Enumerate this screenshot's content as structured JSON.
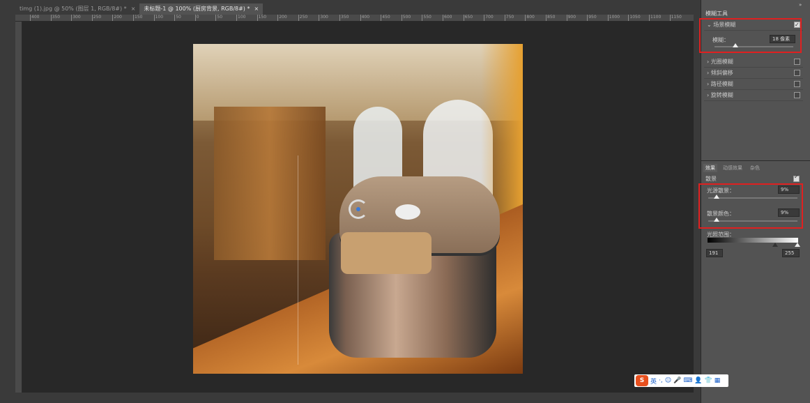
{
  "tabs": [
    {
      "label": "timg (1).jpg @ 50% (图层 1, RGB/8#) *",
      "close": "×",
      "active": false
    },
    {
      "label": "未标题-1 @ 100% (厨房背景, RGB/8#) *",
      "close": "×",
      "active": true
    }
  ],
  "ruler": {
    "top_labels": [
      "400",
      "350",
      "300",
      "250",
      "200",
      "150",
      "100",
      "50",
      "0",
      "50",
      "100",
      "150",
      "200",
      "250",
      "300",
      "350",
      "400",
      "450",
      "500",
      "550",
      "600",
      "650",
      "700",
      "750",
      "800",
      "850",
      "900",
      "950",
      "1000",
      "1050",
      "1100",
      "1150"
    ]
  },
  "blur_tools": {
    "tab": "模糊工具",
    "collapse_icon": "double-arrow-icon",
    "field_blur": {
      "label": "场景模糊",
      "checked": true,
      "blur_label": "模糊：",
      "blur_value": "18 像素",
      "slider_pct": 30
    },
    "others": [
      {
        "label": "光圈模糊",
        "checked": false
      },
      {
        "label": "倾斜偏移",
        "checked": false
      },
      {
        "label": "路径模糊",
        "checked": false
      },
      {
        "label": "旋转模糊",
        "checked": false
      }
    ]
  },
  "effects": {
    "tabs": [
      "效果",
      "动感效果",
      "杂色"
    ],
    "bokeh_label": "散景",
    "bokeh_checked": true,
    "light_bokeh": {
      "label": "光源散景：",
      "value": "9%",
      "slider_pct": 9
    },
    "bokeh_color": {
      "label": "散景颜色：",
      "value": "9%",
      "slider_pct": 9
    },
    "light_range": {
      "label": "光照范围：",
      "low": "191",
      "high": "255"
    }
  },
  "ime": {
    "logo": "S",
    "items": [
      "英",
      "·,",
      "☺",
      "🎤",
      "⌨",
      "👤",
      "👕",
      "▦"
    ]
  },
  "colors": {
    "highlight": "#e02020",
    "panel": "#535353",
    "canvas": "#282828"
  }
}
